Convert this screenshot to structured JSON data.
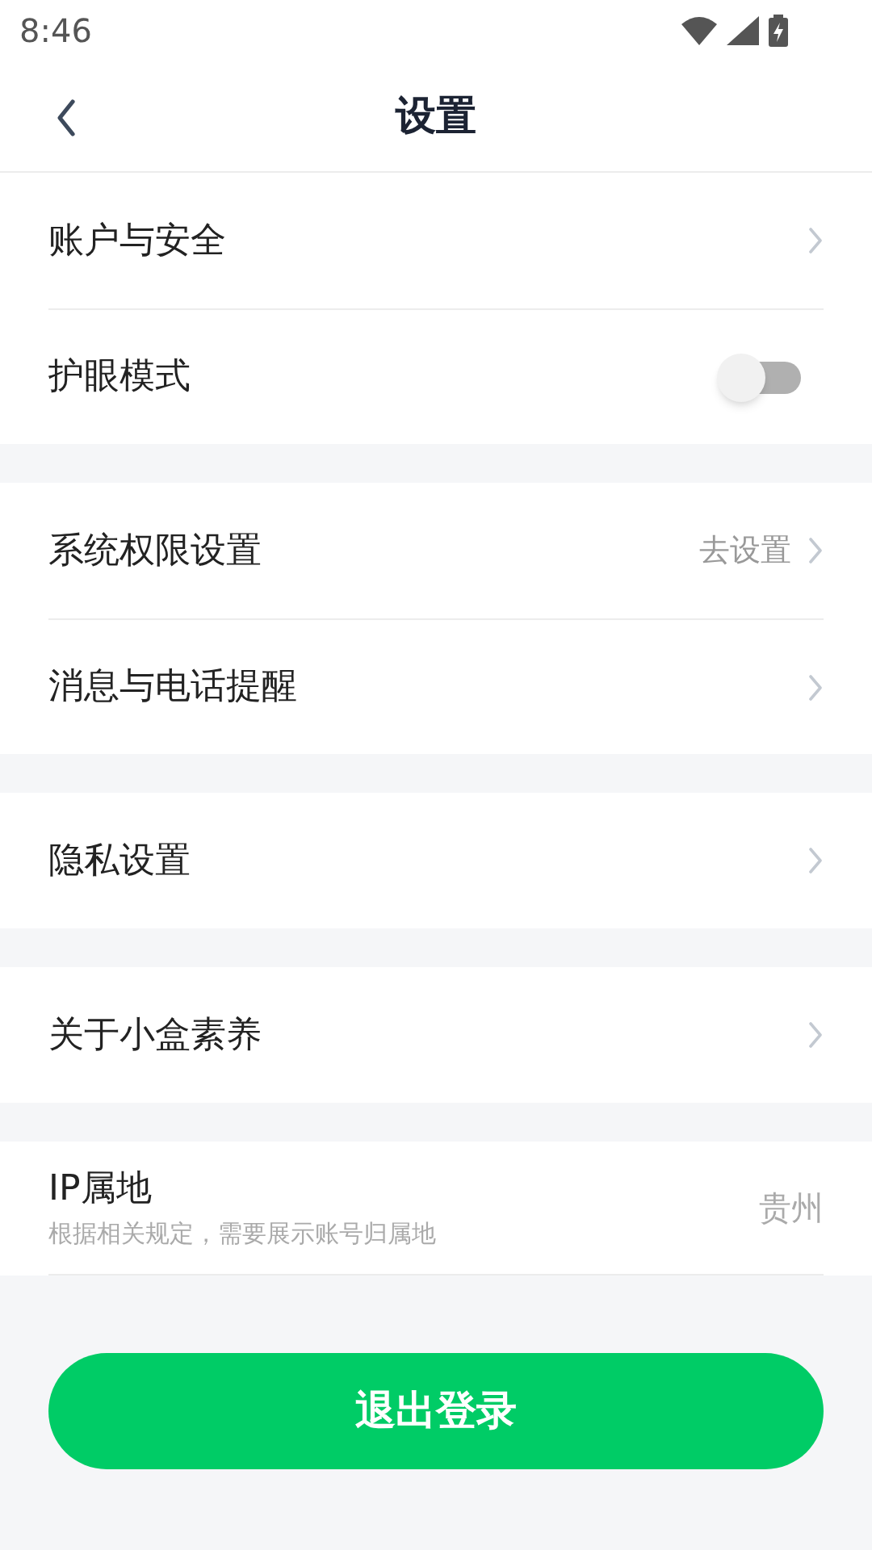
{
  "status_bar": {
    "time": "8:46"
  },
  "header": {
    "title": "设置"
  },
  "groups": [
    {
      "items": [
        {
          "kind": "link",
          "label": "账户与安全"
        },
        {
          "kind": "toggle",
          "label": "护眼模式",
          "on": false
        }
      ]
    },
    {
      "items": [
        {
          "kind": "link",
          "label": "系统权限设置",
          "value": "去设置"
        },
        {
          "kind": "link",
          "label": "消息与电话提醒"
        }
      ]
    },
    {
      "items": [
        {
          "kind": "link",
          "label": "隐私设置"
        }
      ]
    },
    {
      "items": [
        {
          "kind": "link",
          "label": "关于小盒素养"
        }
      ]
    },
    {
      "items": [
        {
          "kind": "info",
          "label": "IP属地",
          "hint": "根据相关规定，需要展示账号归属地",
          "value": "贵州"
        }
      ]
    }
  ],
  "logout_button": {
    "label": "退出登录"
  }
}
